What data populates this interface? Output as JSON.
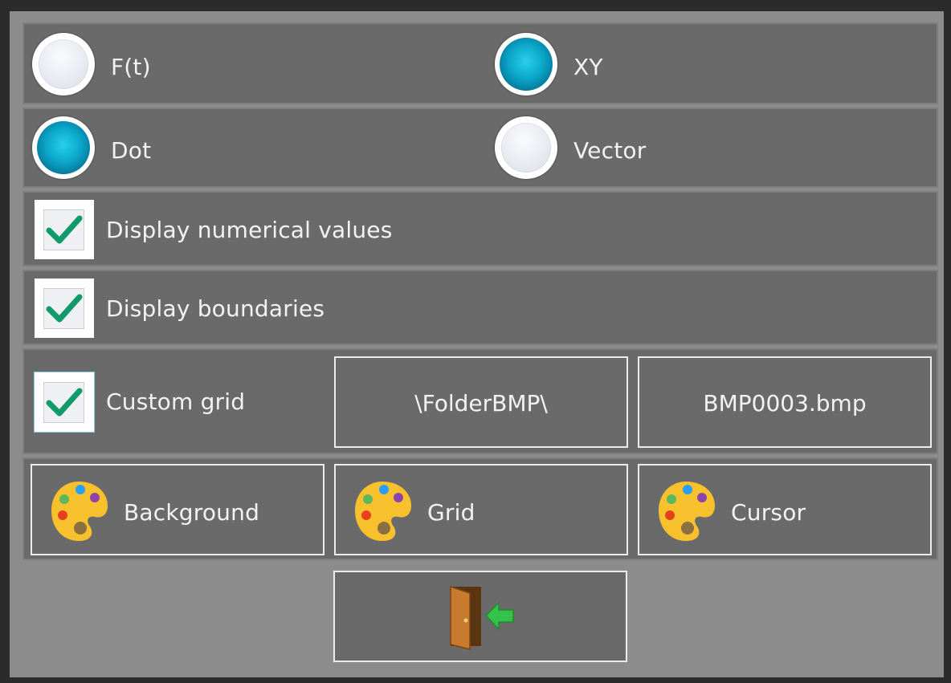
{
  "mode": {
    "ft_label": "F(t)",
    "xy_label": "XY",
    "selected": "XY"
  },
  "draw_style": {
    "dot_label": "Dot",
    "vector_label": "Vector",
    "selected": "Dot"
  },
  "options": {
    "numerical_values_label": "Display numerical values",
    "numerical_values_checked": true,
    "boundaries_label": "Display boundaries",
    "boundaries_checked": true,
    "custom_grid_label": "Custom grid",
    "custom_grid_checked": true
  },
  "grid_file": {
    "folder": "\\FolderBMP\\",
    "filename": "BMP0003.bmp"
  },
  "colors": {
    "background_label": "Background",
    "grid_label": "Grid",
    "cursor_label": "Cursor"
  },
  "exit": {
    "icon": "exit-door-icon"
  },
  "palette": {
    "accent": "#0aa5c8",
    "check": "#0f9a6a",
    "panel": "#6a6a6a"
  }
}
